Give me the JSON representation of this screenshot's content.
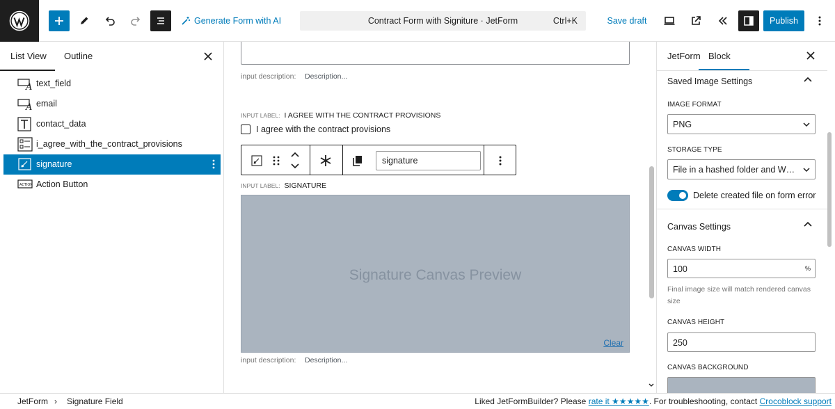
{
  "topbar": {
    "generate_ai_label": "Generate Form with AI",
    "doc_title": "Contract Form with Signiture · JetForm",
    "shortcut": "Ctrl+K",
    "save_draft_label": "Save draft",
    "publish_label": "Publish"
  },
  "left_panel": {
    "tabs": [
      {
        "label": "List View",
        "active": true
      },
      {
        "label": "Outline",
        "active": false
      }
    ],
    "items": [
      {
        "label": "text_field",
        "icon": "text-field-icon"
      },
      {
        "label": "email",
        "icon": "email-field-icon"
      },
      {
        "label": "contact_data",
        "icon": "text-block-icon"
      },
      {
        "label": "i_agree_with_the_contract_provisions",
        "icon": "checkbox-field-icon"
      },
      {
        "label": "signature",
        "icon": "signature-icon",
        "selected": true
      },
      {
        "label": "Action Button",
        "icon": "action-button-icon"
      }
    ]
  },
  "canvas": {
    "desc_label": "input description:",
    "desc_value": "Description...",
    "agree_block": {
      "tag": "INPUT LABEL:",
      "label": "I AGREE WITH THE CONTRACT PROVISIONS",
      "checkbox_label": "I agree with the contract provisions"
    },
    "toolbar": {
      "field_name": "signature"
    },
    "signature_block": {
      "tag": "INPUT LABEL:",
      "label": "SIGNATURE",
      "preview_text": "Signature Canvas Preview",
      "clear_label": "Clear"
    },
    "sig_desc_label": "input description:",
    "sig_desc_value": "Description..."
  },
  "right_panel": {
    "tabs": [
      {
        "label": "JetForm",
        "active": false
      },
      {
        "label": "Block",
        "active": true
      }
    ],
    "saved_image": {
      "title": "Saved Image Settings",
      "format_label": "IMAGE FORMAT",
      "format_value": "PNG",
      "storage_label": "STORAGE TYPE",
      "storage_value": "File in a hashed folder and WP attachment",
      "delete_toggle_label": "Delete created file on form error",
      "delete_toggle_on": true
    },
    "canvas_settings": {
      "title": "Canvas Settings",
      "width_label": "CANVAS WIDTH",
      "width_value": "100",
      "width_unit": "%",
      "width_help": "Final image size will match rendered canvas size",
      "height_label": "CANVAS HEIGHT",
      "height_value": "250",
      "bg_label": "CANVAS BACKGROUND",
      "bg_color": "#aab4bf"
    }
  },
  "footer": {
    "breadcrumb": [
      "JetForm",
      "Signature Field"
    ],
    "note_prefix": "Liked JetFormBuilder? Please ",
    "rate_link": "rate it ★★★★★",
    "note_middle": ". For troubleshooting, contact ",
    "support_link": "Crocoblock support"
  },
  "colors": {
    "accent": "#007cba",
    "dark": "#1e1e1e",
    "canvas_bg": "#aab4bf"
  }
}
